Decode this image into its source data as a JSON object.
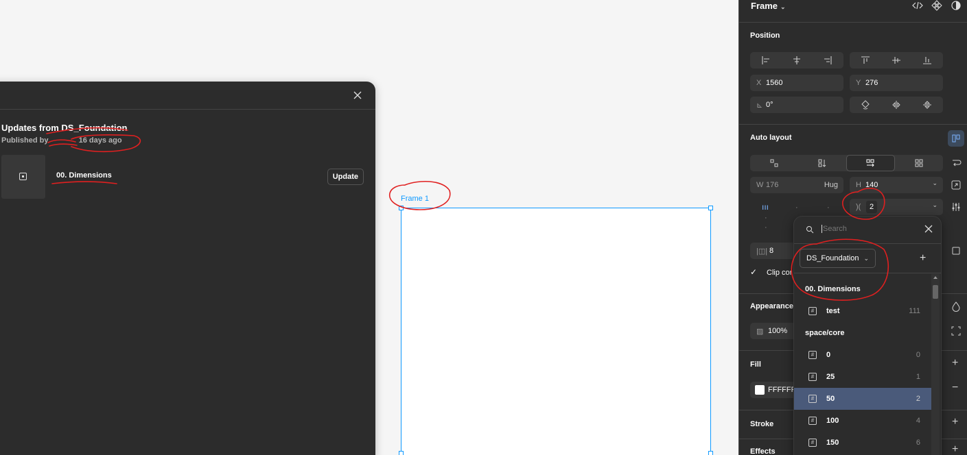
{
  "canvas": {
    "frame_label": "Frame 1"
  },
  "modal": {
    "title": "Updates from DS_Foundation",
    "subtitle_prefix": "Published by",
    "subtitle_suffix": "16 days ago",
    "component_name": "00. Dimensions",
    "update_label": "Update"
  },
  "panel": {
    "title": "Frame",
    "position": {
      "section": "Position",
      "x_label": "X",
      "x_value": "1560",
      "y_label": "Y",
      "y_value": "276",
      "rotation_value": "0°"
    },
    "auto_layout": {
      "section": "Auto layout",
      "w_label": "W",
      "w_value": "176",
      "w_mode": "Hug",
      "h_label": "H",
      "h_value": "140",
      "gap_value": "2",
      "padding_value": "8",
      "clip_label": "Clip cor"
    },
    "appearance": {
      "section": "Appearance",
      "opacity_value": "100%"
    },
    "fill": {
      "section": "Fill",
      "hex_value": "FFFFFF"
    },
    "stroke_label": "Stroke",
    "effects_label": "Effects"
  },
  "dropdown": {
    "search_placeholder": "Search",
    "library_label": "DS_Foundation",
    "collection_title": "00. Dimensions",
    "groups": [
      {
        "items": [
          {
            "name": "test",
            "value": "111"
          }
        ]
      },
      {
        "title": "space/core",
        "items": [
          {
            "name": "0",
            "value": "0"
          },
          {
            "name": "25",
            "value": "1"
          },
          {
            "name": "50",
            "value": "2",
            "selected": true
          },
          {
            "name": "100",
            "value": "4"
          },
          {
            "name": "150",
            "value": "6"
          }
        ]
      }
    ]
  },
  "colors": {
    "selection_blue": "#0d99ff",
    "panel_bg": "#2c2c2c",
    "annotation_red": "#e02020",
    "selected_row": "#4a5a7a"
  }
}
